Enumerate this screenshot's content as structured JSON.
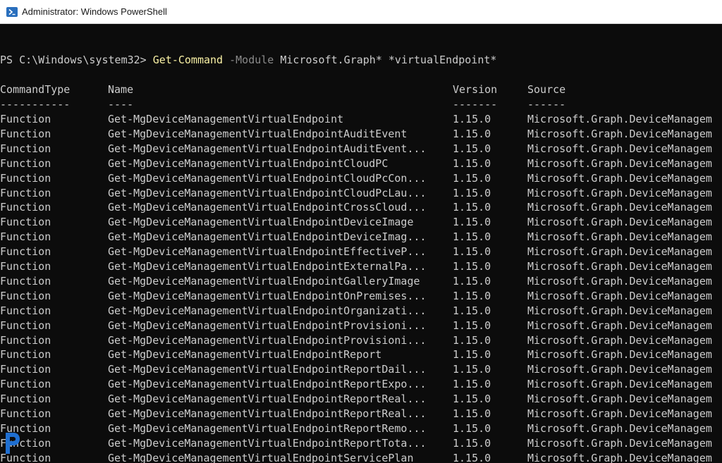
{
  "window": {
    "title": "Administrator: Windows PowerShell",
    "icon": "powershell-icon"
  },
  "prompt": {
    "path": "PS C:\\Windows\\system32>",
    "cmdlet": "Get-Command",
    "parameter": "-Module",
    "arg1": "Microsoft.Graph*",
    "arg2": "*virtualEndpoint*"
  },
  "table": {
    "headers": [
      "CommandType",
      "Name",
      "Version",
      "Source"
    ],
    "separators": [
      "-----------",
      "----",
      "-------",
      "------"
    ],
    "rows": [
      [
        "Function",
        "Get-MgDeviceManagementVirtualEndpoint",
        "1.15.0",
        "Microsoft.Graph.DeviceManagem"
      ],
      [
        "Function",
        "Get-MgDeviceManagementVirtualEndpointAuditEvent",
        "1.15.0",
        "Microsoft.Graph.DeviceManagem"
      ],
      [
        "Function",
        "Get-MgDeviceManagementVirtualEndpointAuditEvent...",
        "1.15.0",
        "Microsoft.Graph.DeviceManagem"
      ],
      [
        "Function",
        "Get-MgDeviceManagementVirtualEndpointCloudPC",
        "1.15.0",
        "Microsoft.Graph.DeviceManagem"
      ],
      [
        "Function",
        "Get-MgDeviceManagementVirtualEndpointCloudPcCon...",
        "1.15.0",
        "Microsoft.Graph.DeviceManagem"
      ],
      [
        "Function",
        "Get-MgDeviceManagementVirtualEndpointCloudPcLau...",
        "1.15.0",
        "Microsoft.Graph.DeviceManagem"
      ],
      [
        "Function",
        "Get-MgDeviceManagementVirtualEndpointCrossCloud...",
        "1.15.0",
        "Microsoft.Graph.DeviceManagem"
      ],
      [
        "Function",
        "Get-MgDeviceManagementVirtualEndpointDeviceImage",
        "1.15.0",
        "Microsoft.Graph.DeviceManagem"
      ],
      [
        "Function",
        "Get-MgDeviceManagementVirtualEndpointDeviceImag...",
        "1.15.0",
        "Microsoft.Graph.DeviceManagem"
      ],
      [
        "Function",
        "Get-MgDeviceManagementVirtualEndpointEffectiveP...",
        "1.15.0",
        "Microsoft.Graph.DeviceManagem"
      ],
      [
        "Function",
        "Get-MgDeviceManagementVirtualEndpointExternalPa...",
        "1.15.0",
        "Microsoft.Graph.DeviceManagem"
      ],
      [
        "Function",
        "Get-MgDeviceManagementVirtualEndpointGalleryImage",
        "1.15.0",
        "Microsoft.Graph.DeviceManagem"
      ],
      [
        "Function",
        "Get-MgDeviceManagementVirtualEndpointOnPremises...",
        "1.15.0",
        "Microsoft.Graph.DeviceManagem"
      ],
      [
        "Function",
        "Get-MgDeviceManagementVirtualEndpointOrganizati...",
        "1.15.0",
        "Microsoft.Graph.DeviceManagem"
      ],
      [
        "Function",
        "Get-MgDeviceManagementVirtualEndpointProvisioni...",
        "1.15.0",
        "Microsoft.Graph.DeviceManagem"
      ],
      [
        "Function",
        "Get-MgDeviceManagementVirtualEndpointProvisioni...",
        "1.15.0",
        "Microsoft.Graph.DeviceManagem"
      ],
      [
        "Function",
        "Get-MgDeviceManagementVirtualEndpointReport",
        "1.15.0",
        "Microsoft.Graph.DeviceManagem"
      ],
      [
        "Function",
        "Get-MgDeviceManagementVirtualEndpointReportDail...",
        "1.15.0",
        "Microsoft.Graph.DeviceManagem"
      ],
      [
        "Function",
        "Get-MgDeviceManagementVirtualEndpointReportExpo...",
        "1.15.0",
        "Microsoft.Graph.DeviceManagem"
      ],
      [
        "Function",
        "Get-MgDeviceManagementVirtualEndpointReportReal...",
        "1.15.0",
        "Microsoft.Graph.DeviceManagem"
      ],
      [
        "Function",
        "Get-MgDeviceManagementVirtualEndpointReportReal...",
        "1.15.0",
        "Microsoft.Graph.DeviceManagem"
      ],
      [
        "Function",
        "Get-MgDeviceManagementVirtualEndpointReportRemo...",
        "1.15.0",
        "Microsoft.Graph.DeviceManagem"
      ],
      [
        "Function",
        "Get-MgDeviceManagementVirtualEndpointReportTota...",
        "1.15.0",
        "Microsoft.Graph.DeviceManagem"
      ],
      [
        "Function",
        "Get-MgDeviceManagementVirtualEndpointServicePlan",
        "1.15.0",
        "Microsoft.Graph.DeviceManagem"
      ]
    ]
  },
  "colors": {
    "background": "#0c0c0c",
    "text": "#cccccc",
    "command": "#f9f1a5",
    "parameter": "#8a8a8a",
    "icon_blue": "#2a6fbd",
    "watermark_blue": "#1f6fd1"
  },
  "watermark": {
    "icon": "p-logo-icon"
  }
}
